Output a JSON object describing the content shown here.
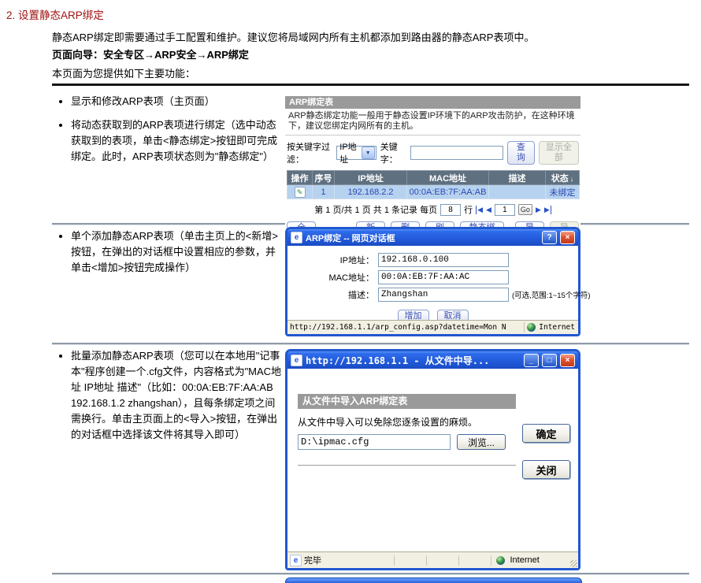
{
  "doc": {
    "heading": "2. 设置静态ARP绑定",
    "intro": "静态ARP绑定即需要通过手工配置和维护。建议您将局域网内所有主机都添加到路由器的静态ARP表项中。",
    "wizard": "页面向导：安全专区→ARP安全→ARP绑定",
    "features_intro": "本页面为您提供如下主要功能："
  },
  "sections": {
    "s1": {
      "bullets": [
        "显示和修改ARP表项（主页面）",
        "将动态获取到的ARP表项进行绑定（选中动态获取到的表项，单击<静态绑定>按钮即可完成绑定。此时，ARP表项状态则为\"静态绑定\"）"
      ]
    },
    "s2": {
      "bullets": [
        "单个添加静态ARP表项（单击主页上的<新增>按钮，在弹出的对话框中设置相应的参数，并单击<增加>按钮完成操作）"
      ]
    },
    "s3": {
      "bullets": [
        "批量添加静态ARP表项（您可以在本地用\"记事本\"程序创建一个.cfg文件，内容格式为\"MAC地址 IP地址 描述\"（比如：00:0A:EB:7F:AA:AB 192.168.1.2 zhangshan），且每条绑定项之间需换行。单击主页面上的<导入>按钮，在弹出的对话框中选择该文件将其导入即可）"
      ]
    }
  },
  "arp_table": {
    "title": "ARP绑定表",
    "description": "ARP静态绑定功能一般用于静态设置IP环境下的ARP攻击防护，在这种环境下，建议您绑定内网所有的主机。",
    "filter": {
      "label": "按关键字过滤：",
      "type_value": "IP地址",
      "keyword_label": "关键字：",
      "keyword_value": "",
      "query": "查询",
      "show_all": "显示全部"
    },
    "columns": [
      "操作",
      "序号",
      "IP地址",
      "MAC地址",
      "描述",
      "状态"
    ],
    "row": {
      "seq": "1",
      "ip": "192.168.2.2",
      "mac": "00:0A:EB:7F:AA:AB",
      "desc": "",
      "status": "未绑定"
    },
    "pagination": {
      "prefix": "第 1 页/共 1 页 共 1 条记录 每页",
      "per_page": "8",
      "rows_suffix": "行",
      "page": "1",
      "go": "Go"
    },
    "actions": {
      "select_all": "全选",
      "add": "新增",
      "remove": "删除",
      "refresh": "刷新",
      "static_bind": "静态绑定",
      "import": "导入",
      "export": "导出"
    }
  },
  "add_dialog": {
    "title": "ARP绑定 -- 网页对话框",
    "fields": {
      "ip": {
        "label": "IP地址：",
        "value": "192.168.0.100"
      },
      "mac": {
        "label": "MAC地址：",
        "value": "00:0A:EB:7F:AA:AC"
      },
      "desc": {
        "label": "描述：",
        "value": "Zhangshan",
        "hint": "(可选,范围:1~15个字符)"
      }
    },
    "buttons": {
      "add": "增加",
      "cancel": "取消"
    },
    "status": {
      "url": "http://192.168.1.1/arp_config.asp?datetime=Mon N",
      "zone": "Internet"
    }
  },
  "import_window": {
    "title": "http://192.168.1.1 - 从文件中导...",
    "panel_title": "从文件中导入ARP绑定表",
    "description": "从文件中导入可以免除您逐条设置的麻烦。",
    "file_path": "D:\\ipmac.cfg",
    "browse": "浏览...",
    "ok": "确定",
    "close": "关闭",
    "status": {
      "text": "完毕",
      "zone": "Internet"
    }
  },
  "icons": {
    "edit": "✎",
    "sort_down": "↓",
    "dropdown": "▼",
    "nav_prev": "◀",
    "nav_next": "▶",
    "help": "?",
    "close": "×",
    "minimize": "_",
    "maximize": "□",
    "ie_logo": "e"
  },
  "colors": {
    "heading_red": "#a01212",
    "table_header_bg": "#5f7080",
    "table_row_bg": "#b7d2ee",
    "titlebar_blue": "#2157d0",
    "gray_bar": "#9a9a9a"
  }
}
